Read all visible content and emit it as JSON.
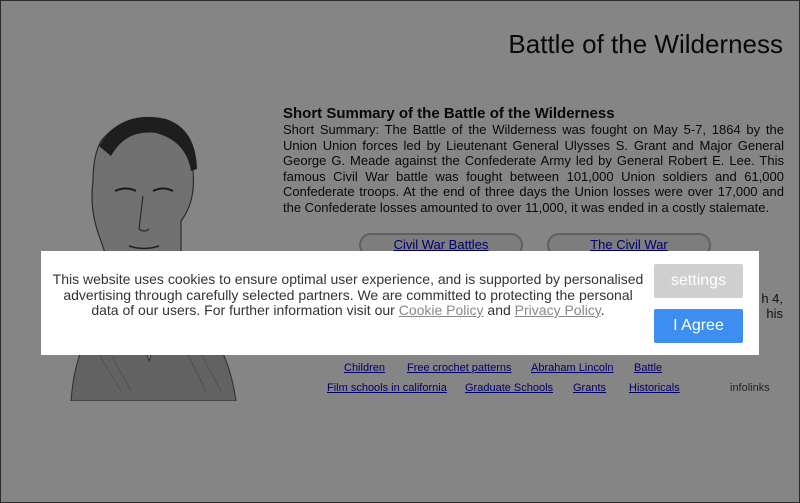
{
  "page": {
    "title": "Battle of the Wilderness"
  },
  "summary": {
    "heading": "Short Summary of the Battle of the Wilderness",
    "body": "Short Summary: The Battle of the Wilderness was fought on May 5-7, 1864 by the Union Union  forces led by Lieutenant General Ulysses S. Grant and Major General George G. Meade against the Confederate Army led by General Robert E. Lee. This famous Civil War battle was fought between 101,000 Union soldiers and 61,000 Confederate troops. At the end of three days the Union losses were over 17,000 and the Confederate losses amounted to over 11,000,  it was ended in a costly stalemate."
  },
  "nav": {
    "civil_war_battles": "Civil War Battles",
    "the_civil_war": "The Civil War"
  },
  "partial_text": {
    "right_line1": "h 4,",
    "right_line2": "his"
  },
  "ad_links": {
    "row1": [
      "Children",
      "Free crochet patterns",
      "Abraham Lincoln",
      "Battle"
    ],
    "row2": [
      "Film schools in california",
      "Graduate Schools",
      "Grants",
      "Historicals"
    ],
    "brand": "infolinks"
  },
  "cookie": {
    "text_before": "This website uses cookies to ensure optimal user experience, and is supported by personalised advertising through carefully selected partners. We are committed to protecting the personal data of our users. For further information visit our ",
    "cookie_policy": "Cookie Policy",
    "and": " and ",
    "privacy_policy": "Privacy Policy",
    "period": ".",
    "settings_label": "settings",
    "agree_label": "I Agree"
  }
}
